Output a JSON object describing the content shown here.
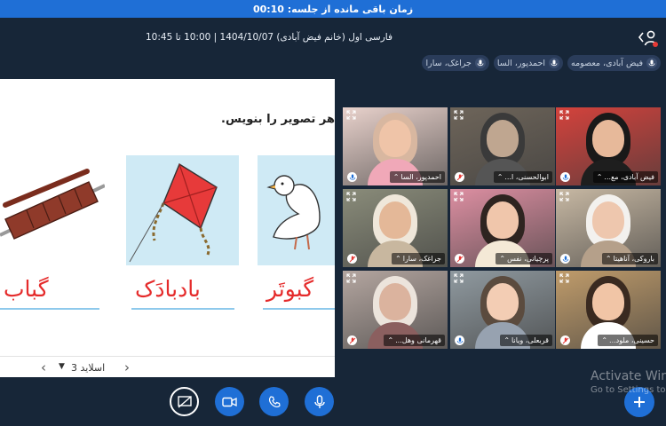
{
  "timer": {
    "text": "زمان باقی مانده از جلسه: 00:10"
  },
  "session": {
    "title": "فارسی اول (خانم فیض آبادی) 1404/10/07 | 10:00 تا 10:45"
  },
  "chips": [
    {
      "name": "فیض آبادی، معصومه"
    },
    {
      "name": "احمدپور، السا"
    },
    {
      "name": "جراغک، سارا"
    }
  ],
  "slide": {
    "instruction": "هر تصویر را بنویس.",
    "words": [
      "گبوتَر",
      "بادبادَک",
      "گباب"
    ],
    "label": "اسلاید 3"
  },
  "tiles": [
    {
      "name": "فیض آبادی، مع...",
      "mic": "plain",
      "bg": "#d4423c",
      "skin": "#e7b99a",
      "hood": "#191919",
      "body": "#1e1e1e"
    },
    {
      "name": "ابوالحسنی، ا...",
      "mic": "muted",
      "bg": "#6e655a",
      "skin": "#bfa690",
      "hood": "#3a3a3a",
      "body": "#555"
    },
    {
      "name": "احمدپور، السا",
      "mic": "plain",
      "bg": "#e9d2cc",
      "skin": "#efc4a8",
      "hood": "#d8b7a0",
      "body": "#f0a8b8"
    },
    {
      "name": "باروکی، آناهیتا",
      "mic": "plain",
      "bg": "#c7b8a3",
      "skin": "#eec7ae",
      "hood": "#f3f1ee",
      "body": "#b5a08a"
    },
    {
      "name": "پرچیانی، نفس",
      "mic": "muted",
      "bg": "#dd8fa2",
      "skin": "#f0c6ab",
      "hood": "#2e2420",
      "body": "#f4e9d6"
    },
    {
      "name": "جراغک، سارا",
      "mic": "muted",
      "bg": "#8a8c7a",
      "skin": "#e4b898",
      "hood": "#efe7da",
      "body": "#c8b79f"
    },
    {
      "name": "حسینی، ملود...",
      "mic": "muted",
      "bg": "#c09c6b",
      "skin": "#f1c5a6",
      "hood": "#3a2a20",
      "body": "#ffffff"
    },
    {
      "name": "قربعلی، ویانا",
      "mic": "plain",
      "bg": "#909aa0",
      "skin": "#f3cdb4",
      "hood": "#5b4b3e",
      "body": "#97a2b0"
    },
    {
      "name": "قهرمانی وهل...",
      "mic": "muted",
      "bg": "#b4a6a0",
      "skin": "#dbb39e",
      "hood": "#ece4dc",
      "body": "#8b5f5f"
    }
  ],
  "watermark": {
    "line1": "Activate Win",
    "line2": "Go to Settings to a"
  },
  "colors": {
    "accent": "#1f6fd6",
    "background": "#172638",
    "word": "#e52b2b",
    "mute": "#e53935"
  }
}
